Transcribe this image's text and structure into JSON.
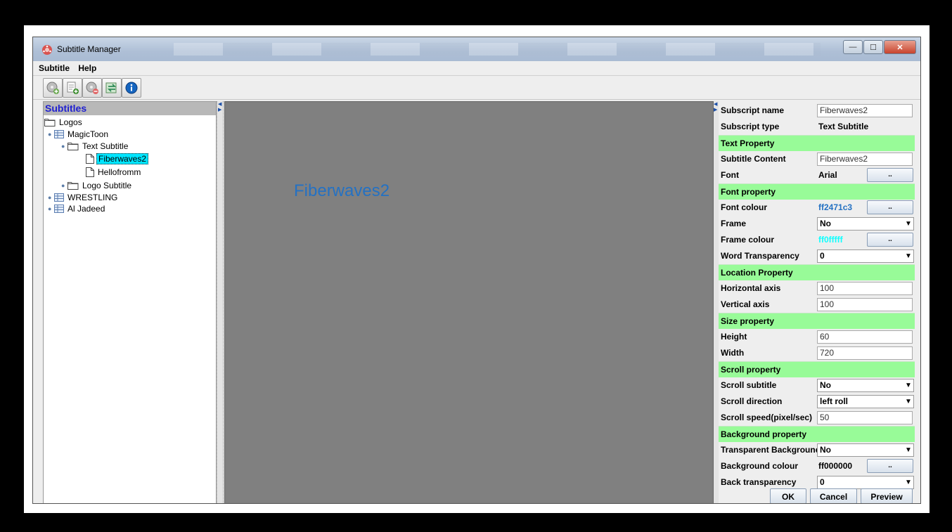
{
  "window": {
    "title": "Subtitle Manager",
    "controls": {
      "minimize": "—",
      "maximize": "☐",
      "close": "✕"
    }
  },
  "menubar": [
    "Subtitle",
    "Help"
  ],
  "toolbar": [
    {
      "icon": "add-reel-icon",
      "color": "#6aa84f"
    },
    {
      "icon": "add-document-icon",
      "color": "#3c8d2f"
    },
    {
      "icon": "delete-reel-icon",
      "color": "#e06666"
    },
    {
      "icon": "sync-export-icon",
      "color": "#2e8b57"
    },
    {
      "icon": "info-icon",
      "color": "#1565c0"
    }
  ],
  "tree": {
    "header": "Subtitles",
    "nodes": {
      "logos": "Logos",
      "magictoon": "MagicToon",
      "text_subtitle": "Text Subtitle",
      "fiberwaves2": "Fiberwaves2",
      "hellofromm": "Hellofromm",
      "logo_subtitle": "Logo Subtitle",
      "wrestling": "WRESTLING",
      "al_jadeed": "Al Jadeed"
    }
  },
  "canvas": {
    "preview_text": "Fiberwaves2",
    "text_color": "#2471c3"
  },
  "properties": {
    "subscript_name": {
      "label": "Subscript name",
      "value": "Fiberwaves2"
    },
    "subscript_type": {
      "label": "Subscript type",
      "value": "Text Subtitle"
    },
    "text_property": "Text Property",
    "subtitle_content": {
      "label": "Subtitle Content",
      "value": "Fiberwaves2"
    },
    "font": {
      "label": "Font",
      "value": "Arial",
      "button": ".."
    },
    "font_property": "Font property",
    "font_colour": {
      "label": "Font colour",
      "value": "ff2471c3",
      "button": "..",
      "color": "#2471c3"
    },
    "frame": {
      "label": "Frame",
      "value": "No"
    },
    "frame_colour": {
      "label": "Frame colour",
      "value": "ff0fffff",
      "button": "..",
      "color": "#0fffff"
    },
    "word_transparency": {
      "label": "Word Transparency",
      "value": "0"
    },
    "location_property": "Location Property",
    "horizontal_axis": {
      "label": "Horizontal axis",
      "value": "100"
    },
    "vertical_axis": {
      "label": "Vertical axis",
      "value": "100"
    },
    "size_property": "Size property",
    "height": {
      "label": "Height",
      "value": "60"
    },
    "width": {
      "label": "Width",
      "value": "720"
    },
    "scroll_property": "Scroll property",
    "scroll_subtitle": {
      "label": "Scroll subtitle",
      "value": "No"
    },
    "scroll_direction": {
      "label": "Scroll direction",
      "value": "left roll"
    },
    "scroll_speed": {
      "label": "Scroll speed(pixel/sec)",
      "value": "50"
    },
    "background_property": "Background property",
    "transparent_background": {
      "label": "Transparent Background",
      "value": "No"
    },
    "background_colour": {
      "label": "Background colour",
      "value": "ff000000",
      "button": ".."
    },
    "back_transparency": {
      "label": "Back transparency",
      "value": "0"
    }
  },
  "buttons": {
    "ok": "OK",
    "cancel": "Cancel",
    "preview": "Preview"
  }
}
